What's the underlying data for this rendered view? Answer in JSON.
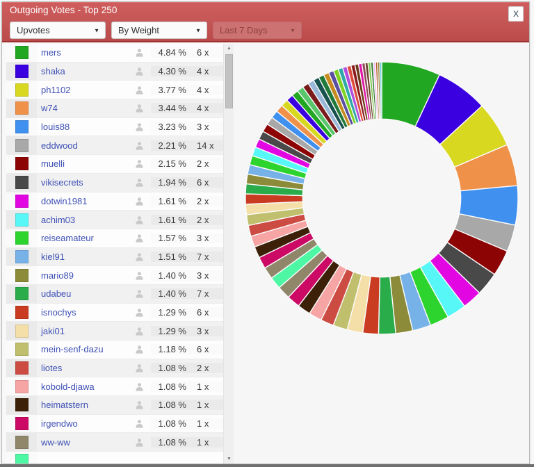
{
  "window": {
    "title": "Outgoing Votes - Top 250",
    "close_label": "X",
    "titlebar_color": "#c65757",
    "titlebar_border_color": "#9e2f2f"
  },
  "toolbar": {
    "filters": [
      {
        "name": "vote-type",
        "value": "Upvotes",
        "caret": "▼",
        "disabled": false
      },
      {
        "name": "sort-order",
        "value": "By Weight",
        "caret": "▼",
        "disabled": false
      },
      {
        "name": "time-range",
        "value": "Last 7 Days",
        "caret": "▼",
        "disabled": true
      }
    ]
  },
  "list": {
    "columns": [
      "color",
      "account",
      "user",
      "weight_percent",
      "votes_count"
    ],
    "rows": [
      {
        "color": "#22a722",
        "name": "mers",
        "percent": "4.84 %",
        "count": "6 x"
      },
      {
        "color": "#3a00e0",
        "name": "shaka",
        "percent": "4.30 %",
        "count": "4 x"
      },
      {
        "color": "#d8d820",
        "name": "ph1102",
        "percent": "3.77 %",
        "count": "4 x"
      },
      {
        "color": "#f0914a",
        "name": "w74",
        "percent": "3.44 %",
        "count": "4 x"
      },
      {
        "color": "#4090f0",
        "name": "louis88",
        "percent": "3.23 %",
        "count": "3 x"
      },
      {
        "color": "#a8a8a8",
        "name": "eddwood",
        "percent": "2.21 %",
        "count": "14 x"
      },
      {
        "color": "#8c0404",
        "name": "muelli",
        "percent": "2.15 %",
        "count": "2 x"
      },
      {
        "color": "#494949",
        "name": "vikisecrets",
        "percent": "1.94 %",
        "count": "6 x"
      },
      {
        "color": "#e207e2",
        "name": "dotwin1981",
        "percent": "1.61 %",
        "count": "2 x"
      },
      {
        "color": "#58f7f7",
        "name": "achim03",
        "percent": "1.61 %",
        "count": "2 x"
      },
      {
        "color": "#2ed42e",
        "name": "reiseamateur",
        "percent": "1.57 %",
        "count": "3 x"
      },
      {
        "color": "#76b2e8",
        "name": "kiel91",
        "percent": "1.51 %",
        "count": "7 x"
      },
      {
        "color": "#8b8b3a",
        "name": "mario89",
        "percent": "1.40 %",
        "count": "3 x"
      },
      {
        "color": "#2aac4a",
        "name": "udabeu",
        "percent": "1.40 %",
        "count": "7 x"
      },
      {
        "color": "#c93c22",
        "name": "isnochys",
        "percent": "1.29 %",
        "count": "6 x"
      },
      {
        "color": "#f5dfa8",
        "name": "jaki01",
        "percent": "1.29 %",
        "count": "3 x"
      },
      {
        "color": "#bfbf6d",
        "name": "mein-senf-dazu",
        "percent": "1.18 %",
        "count": "6 x"
      },
      {
        "color": "#cc4b42",
        "name": "liotes",
        "percent": "1.08 %",
        "count": "2 x"
      },
      {
        "color": "#f6a4a4",
        "name": "kobold-djawa",
        "percent": "1.08 %",
        "count": "1 x"
      },
      {
        "color": "#3d2008",
        "name": "heimatstern",
        "percent": "1.08 %",
        "count": "1 x"
      },
      {
        "color": "#cc0a66",
        "name": "irgendwo",
        "percent": "1.08 %",
        "count": "1 x"
      },
      {
        "color": "#90876b",
        "name": "ww-ww",
        "percent": "1.08 %",
        "count": "1 x"
      },
      {
        "color": "#4ef7a4",
        "name": "",
        "percent": "",
        "count": ""
      }
    ],
    "user_icon": "person-icon"
  },
  "scrollbar": {
    "up_arrow": "▲",
    "down_arrow": "▼"
  },
  "chart_data": {
    "type": "pie",
    "variant": "donut",
    "title": "Outgoing Votes - Top 250",
    "value_unit": "%",
    "start_angle_deg": 0,
    "direction": "clockwise",
    "inner_radius_ratio": 0.58,
    "labels": [
      "mers",
      "shaka",
      "ph1102",
      "w74",
      "louis88",
      "eddwood",
      "muelli",
      "vikisecrets",
      "dotwin1981",
      "achim03",
      "reiseamateur",
      "kiel91",
      "mario89",
      "udabeu",
      "isnochys",
      "jaki01",
      "mein-senf-dazu",
      "liotes",
      "kobold-djawa",
      "heimatstern",
      "irgendwo",
      "ww-ww"
    ],
    "values": [
      4.84,
      4.3,
      3.77,
      3.44,
      3.23,
      2.21,
      2.15,
      1.94,
      1.61,
      1.61,
      1.57,
      1.51,
      1.4,
      1.4,
      1.29,
      1.29,
      1.18,
      1.08,
      1.08,
      1.08,
      1.08,
      1.08
    ],
    "colors": [
      "#22a722",
      "#3a00e0",
      "#d8d820",
      "#f0914a",
      "#4090f0",
      "#a8a8a8",
      "#8c0404",
      "#494949",
      "#e207e2",
      "#58f7f7",
      "#2ed42e",
      "#76b2e8",
      "#8b8b3a",
      "#2aac4a",
      "#c93c22",
      "#f5dfa8",
      "#bfbf6d",
      "#cc4b42",
      "#f6a4a4",
      "#3d2008",
      "#cc0a66",
      "#90876b"
    ],
    "tail_slices": {
      "note": "remaining Top-250 accounts rendered as thin equal-ish slices",
      "values": [
        1.0,
        0.98,
        0.96,
        0.94,
        0.92,
        0.9,
        0.88,
        0.86,
        0.84,
        0.82,
        0.8,
        0.78,
        0.76,
        0.74,
        0.72,
        0.7,
        0.68,
        0.66,
        0.64,
        0.62,
        0.6,
        0.58,
        0.56,
        0.54,
        0.52,
        0.5,
        0.48,
        0.46,
        0.44,
        0.42,
        0.4,
        0.38,
        0.36,
        0.34,
        0.32,
        0.3,
        0.28,
        0.26,
        0.24,
        0.22,
        0.2,
        0.19,
        0.18,
        0.17,
        0.16
      ],
      "colors": [
        "#4ef7a4",
        "#90876b",
        "#cc0a66",
        "#3d2008",
        "#f6a4a4",
        "#cc4b42",
        "#bfbf6d",
        "#f5dfa8",
        "#c93c22",
        "#2aac4a",
        "#8b8b3a",
        "#76b2e8",
        "#2ed42e",
        "#58f7f7",
        "#e207e2",
        "#494949",
        "#8c0404",
        "#a8a8a8",
        "#4090f0",
        "#f0914a",
        "#d8d820",
        "#3a00e0",
        "#22a722",
        "#59c66b",
        "#7a1b1b",
        "#9ab8d8",
        "#18524f",
        "#1f7a3a",
        "#c78b1f",
        "#5a4fa0",
        "#7ed321",
        "#2fa8a8",
        "#b14ee0",
        "#e04c3c",
        "#8b1a1a",
        "#6b3a1a",
        "#e016a8",
        "#8f4a5a",
        "#6b3f2a",
        "#7ec850",
        "#2f7a2f",
        "#f0b8f0",
        "#b5642a",
        "#8e7a2a",
        "#4ec8d8"
      ]
    },
    "legend": {
      "position": "left-list",
      "entries_visible": 22
    }
  }
}
